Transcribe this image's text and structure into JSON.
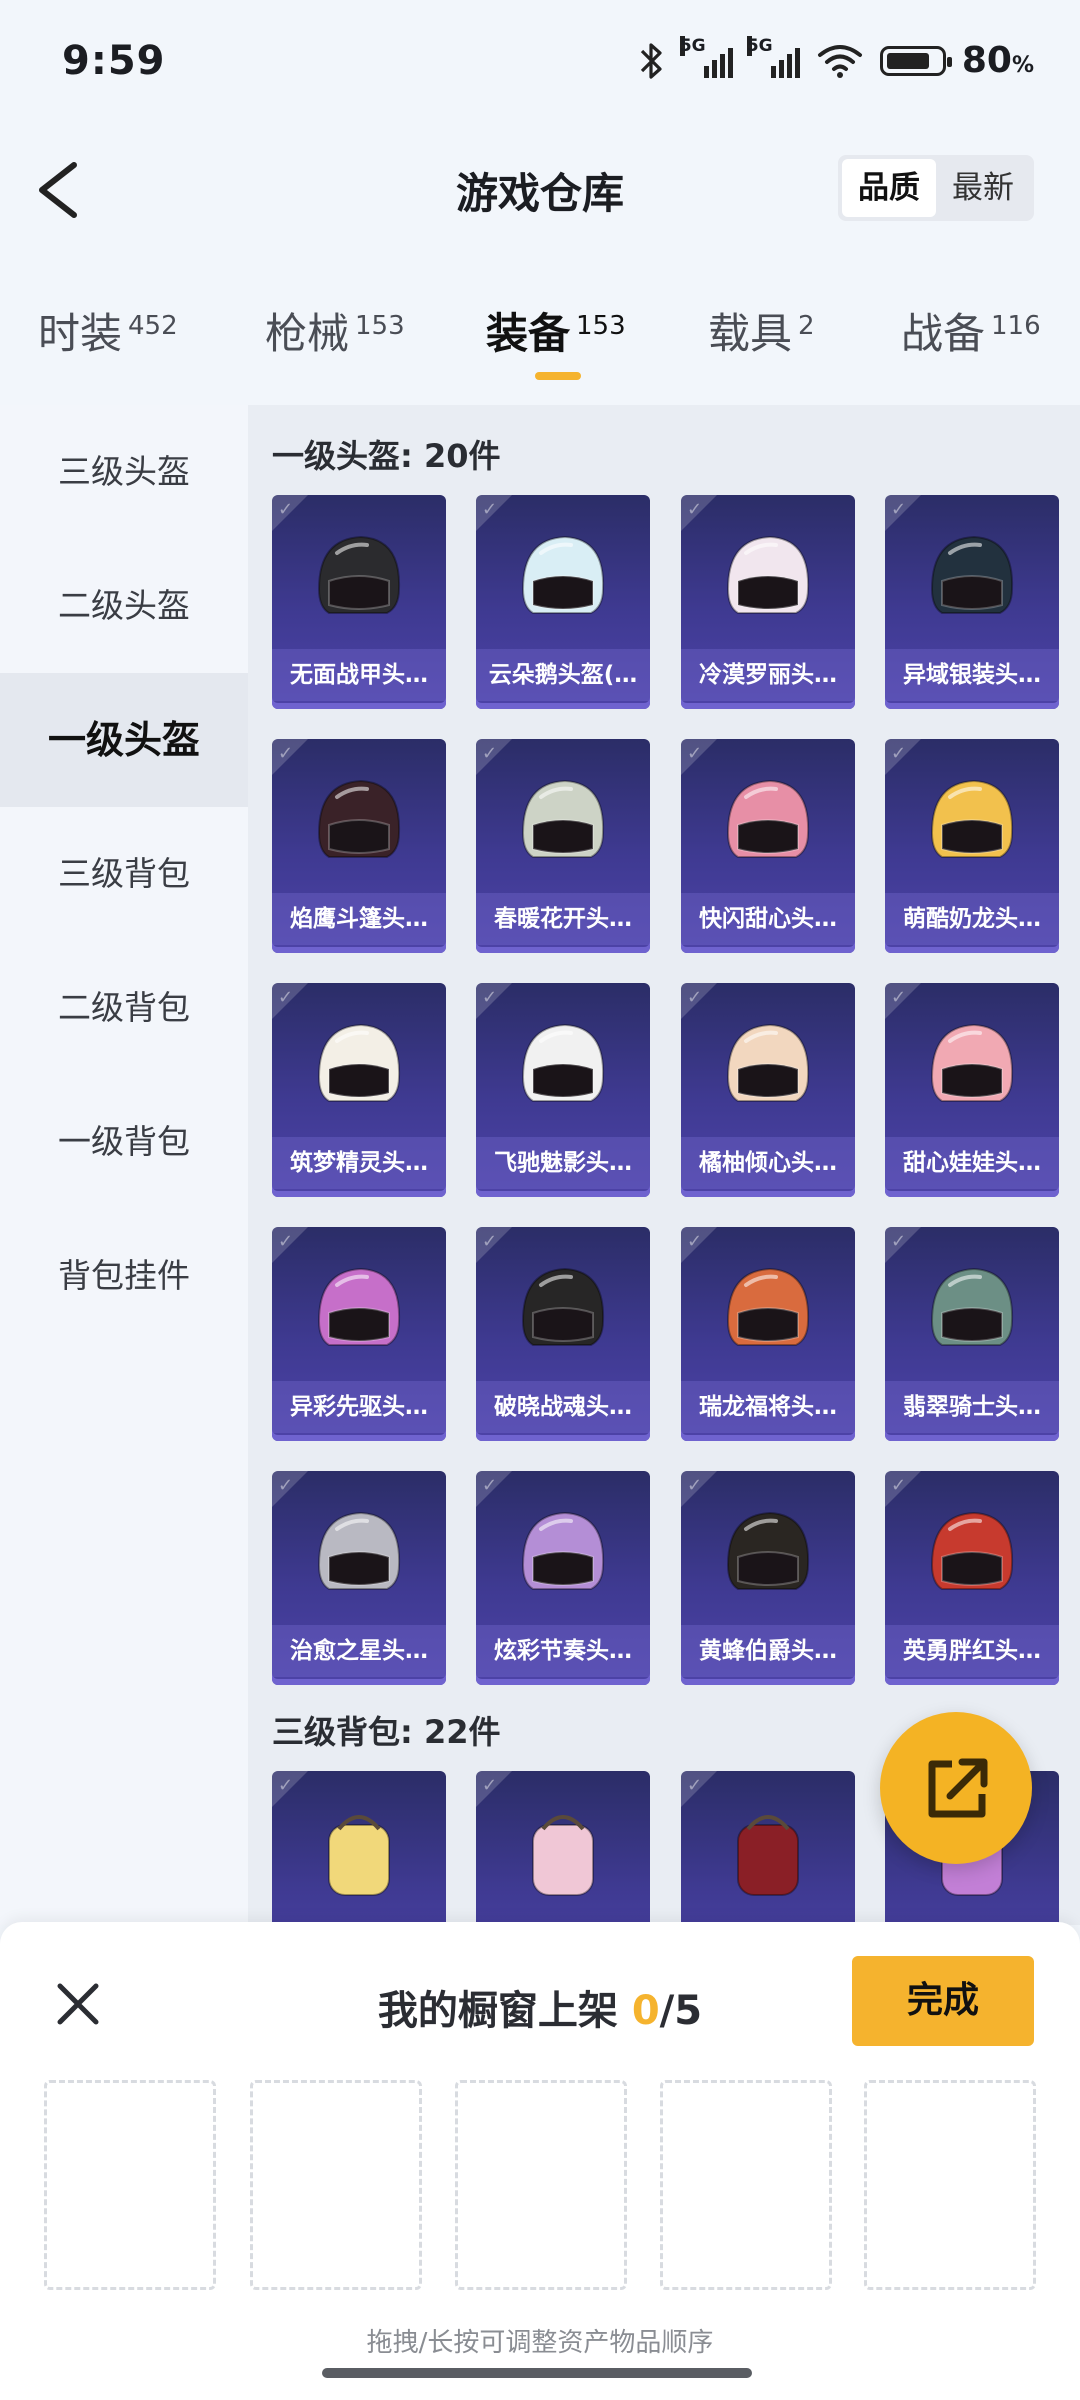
{
  "status_bar": {
    "time": "9:59",
    "network_tag_1": "5G",
    "network_tag_2": "5G",
    "battery_text": "80",
    "battery_unit": "%",
    "battery_level": 0.8
  },
  "header": {
    "title": "游戏仓库",
    "sort_options": [
      "品质",
      "最新"
    ],
    "active_sort": "品质"
  },
  "tabs": [
    {
      "label": "时装",
      "count": "452"
    },
    {
      "label": "枪械",
      "count": "153"
    },
    {
      "label": "装备",
      "count": "153"
    },
    {
      "label": "载具",
      "count": "2"
    },
    {
      "label": "战备",
      "count": "116"
    }
  ],
  "active_tab": "装备",
  "sidebar": {
    "items": [
      "三级头盔",
      "二级头盔",
      "一级头盔",
      "三级背包",
      "二级背包",
      "一级背包",
      "背包挂件"
    ],
    "active": "一级头盔"
  },
  "sections": [
    {
      "title": "一级头盔: 20件",
      "items": [
        {
          "name": "无面战甲头…",
          "color": "#2b2b2e"
        },
        {
          "name": "云朵鹅头盔(…",
          "color": "#d9eef5"
        },
        {
          "name": "冷漠罗丽头…",
          "color": "#f1e6ee"
        },
        {
          "name": "异域银装头…",
          "color": "#22313e"
        },
        {
          "name": "焰鹰斗篷头…",
          "color": "#3a2228"
        },
        {
          "name": "春暖花开头…",
          "color": "#cdd3c6"
        },
        {
          "name": "快闪甜心头…",
          "color": "#e78fa6"
        },
        {
          "name": "萌酷奶龙头…",
          "color": "#f2c14d"
        },
        {
          "name": "筑梦精灵头…",
          "color": "#f3efe6"
        },
        {
          "name": "飞驰魅影头…",
          "color": "#f1f1f1"
        },
        {
          "name": "橘柚倾心头…",
          "color": "#f2d7bf"
        },
        {
          "name": "甜心娃娃头…",
          "color": "#f1a9b3"
        },
        {
          "name": "异彩先驱头…",
          "color": "#c66fc9"
        },
        {
          "name": "破晓战魂头…",
          "color": "#272626"
        },
        {
          "name": "瑞龙福将头…",
          "color": "#d96b3e"
        },
        {
          "name": "翡翠骑士头…",
          "color": "#6c8f85"
        },
        {
          "name": "治愈之星头…",
          "color": "#b9b9c2"
        },
        {
          "name": "炫彩节奏头…",
          "color": "#b48ed6"
        },
        {
          "name": "黄蜂伯爵头…",
          "color": "#2a2622"
        },
        {
          "name": "英勇胖红头…",
          "color": "#c73a2e"
        }
      ]
    },
    {
      "title": "三级背包: 22件",
      "items": [
        {
          "name": "",
          "color": "#f1d87a"
        },
        {
          "name": "",
          "color": "#f0c7d6"
        },
        {
          "name": "",
          "color": "#8a1f26"
        },
        {
          "name": "",
          "color": "#c27fd6"
        }
      ]
    }
  ],
  "fab": {
    "icon": "share-out-icon"
  },
  "sheet": {
    "title_prefix": "我的橱窗上架 ",
    "count": "0",
    "total": "/5",
    "done_label": "完成",
    "hint": "拖拽/长按可调整资产物品顺序",
    "slot_count": 5
  }
}
